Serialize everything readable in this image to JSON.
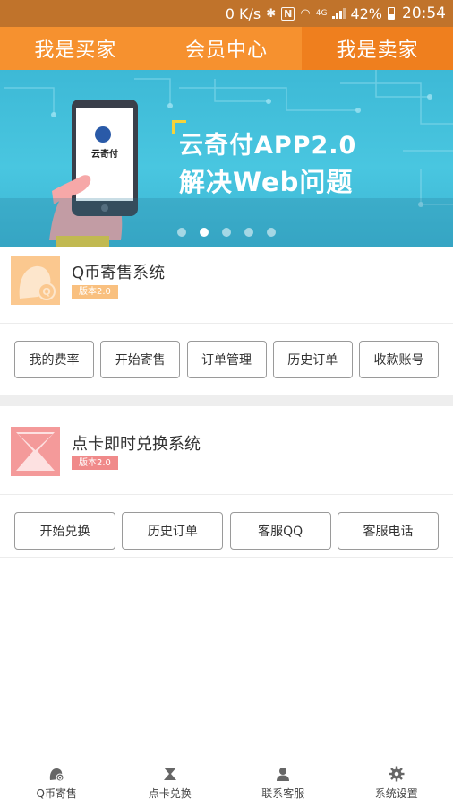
{
  "status_bar": {
    "speed": "0 K/s",
    "network": "4G",
    "battery": "42%",
    "time": "20:54"
  },
  "tabs": [
    {
      "label": "我是买家",
      "active": false
    },
    {
      "label": "会员中心",
      "active": false
    },
    {
      "label": "我是卖家",
      "active": true
    }
  ],
  "banner": {
    "phone_logo": "云奇付",
    "title_line1": "云奇付APP2.0",
    "title_line2": "解决Web问题",
    "slide_count": 5,
    "active_slide": 2
  },
  "sections": [
    {
      "title": "Q币寄售系统",
      "badge": "版本2.0",
      "badge_color": "#f9c07f",
      "logo_color": "#fbc88f",
      "buttons": [
        "我的费率",
        "开始寄售",
        "订单管理",
        "历史订单",
        "收款账号"
      ]
    },
    {
      "title": "点卡即时兑换系统",
      "badge": "版本2.0",
      "badge_color": "#f08a8a",
      "logo_color": "#f49a9a",
      "buttons": [
        "开始兑换",
        "历史订单",
        "客服QQ",
        "客服电话"
      ]
    }
  ],
  "bottom_nav": [
    {
      "label": "Q币寄售",
      "icon": "qcoin-icon"
    },
    {
      "label": "点卡兑换",
      "icon": "hourglass-icon"
    },
    {
      "label": "联系客服",
      "icon": "person-icon"
    },
    {
      "label": "系统设置",
      "icon": "gear-icon"
    }
  ],
  "colors": {
    "primary_orange": "#f6912f",
    "active_tab": "#ef7f1e",
    "status_bar": "#c0732b",
    "banner_blue": "#42bfdc"
  }
}
